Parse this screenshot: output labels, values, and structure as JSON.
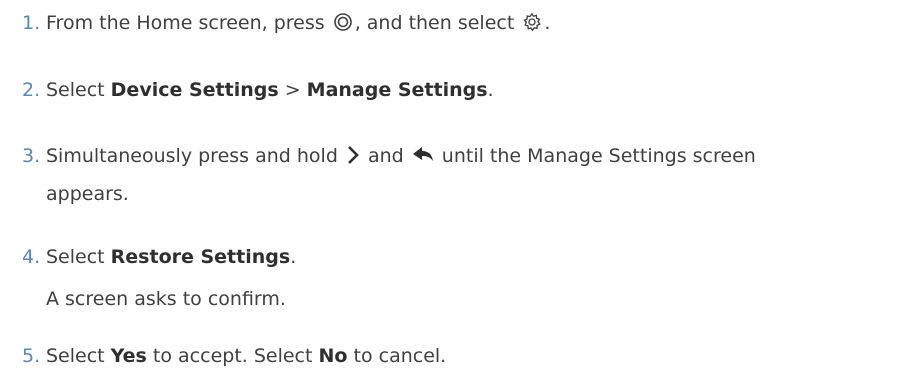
{
  "steps": [
    {
      "number": "1.",
      "text_a": "From the Home screen, press ",
      "icon_a": "ring-button-icon",
      "text_b": ", and then select ",
      "icon_b": "gear-icon",
      "text_c": "."
    },
    {
      "number": "2.",
      "text_a": "Select ",
      "bold_a": "Device Settings",
      "text_b": " > ",
      "bold_b": "Manage Settings",
      "text_c": "."
    },
    {
      "number": "3.",
      "text_a": "Simultaneously press and hold ",
      "icon_a": "chevron-right-icon",
      "text_b": " and ",
      "icon_b": "back-arrow-icon",
      "text_c": " until the Manage Settings screen",
      "text_d": "appears."
    },
    {
      "number": "4.",
      "text_a": "Select ",
      "bold_a": "Restore Settings",
      "text_b": ".",
      "sub_text": "A screen asks to confirm."
    },
    {
      "number": "5.",
      "text_a": "Select ",
      "bold_a": "Yes",
      "text_b": " to accept. Select ",
      "bold_b": "No",
      "text_c": " to cancel."
    }
  ],
  "colors": {
    "number": "#5b86b8",
    "text": "#3f3f3f"
  }
}
